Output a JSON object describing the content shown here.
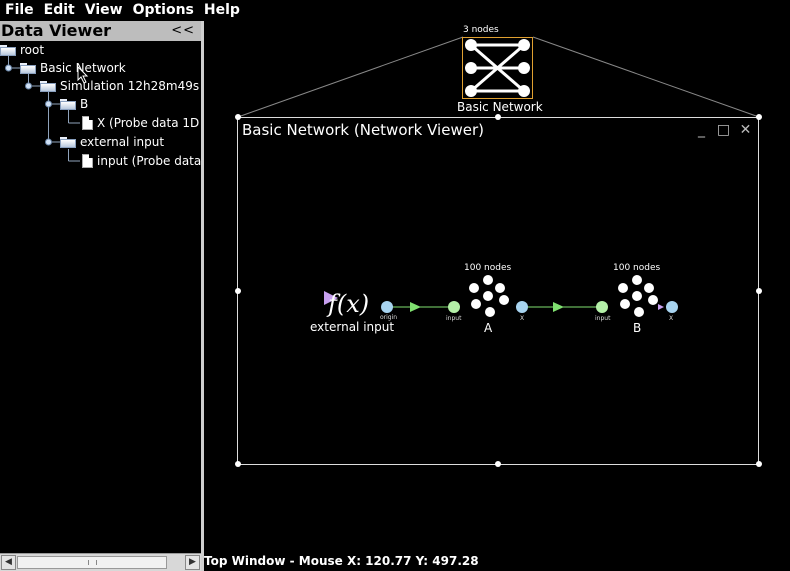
{
  "menu": [
    {
      "label": "File",
      "mnemonic": "F"
    },
    {
      "label": "Edit",
      "mnemonic": "E"
    },
    {
      "label": "View",
      "mnemonic": "V"
    },
    {
      "label": "Options",
      "mnemonic": "O"
    },
    {
      "label": "Help",
      "mnemonic": "H"
    }
  ],
  "data_viewer": {
    "title": "Data Viewer",
    "collapse_label": "<<",
    "tree": [
      {
        "label": "root",
        "icon": "folder-icon"
      },
      {
        "label": "Basic Network",
        "icon": "folder-icon"
      },
      {
        "label": "Simulation 12h28m49s (",
        "icon": "folder-icon"
      },
      {
        "label": "B",
        "icon": "folder-icon"
      },
      {
        "label": "X (Probe data 1D",
        "icon": "document-icon"
      },
      {
        "label": "external input",
        "icon": "folder-icon"
      },
      {
        "label": "input (Probe data",
        "icon": "document-icon"
      }
    ]
  },
  "top_network": {
    "node_count": "3 nodes",
    "caption": "Basic Network"
  },
  "network_viewer": {
    "title": "Basic Network (Network Viewer)",
    "buttons": [
      "minimize-icon",
      "maximize-icon",
      "close-icon"
    ],
    "function_input": {
      "glyph": "f(x)",
      "label": "external input",
      "port": "origin"
    },
    "ensemble_a": {
      "node_count": "100 nodes",
      "label": "A",
      "input_port": "input",
      "output_port": "X"
    },
    "ensemble_b": {
      "node_count": "100 nodes",
      "label": "B",
      "input_port": "input",
      "output_port": "X"
    }
  },
  "status": {
    "text": "Top Window - Mouse X: 120.77 Y: 497.28"
  },
  "colors": {
    "background": "#000000",
    "panel_header": "#bdbdbd",
    "selection_border": "#e0a030",
    "origin_port": "#a8d4f0",
    "termination_port": "#b4f0a8",
    "arrow": "#80e070",
    "function_marker": "#c8a0f0"
  }
}
